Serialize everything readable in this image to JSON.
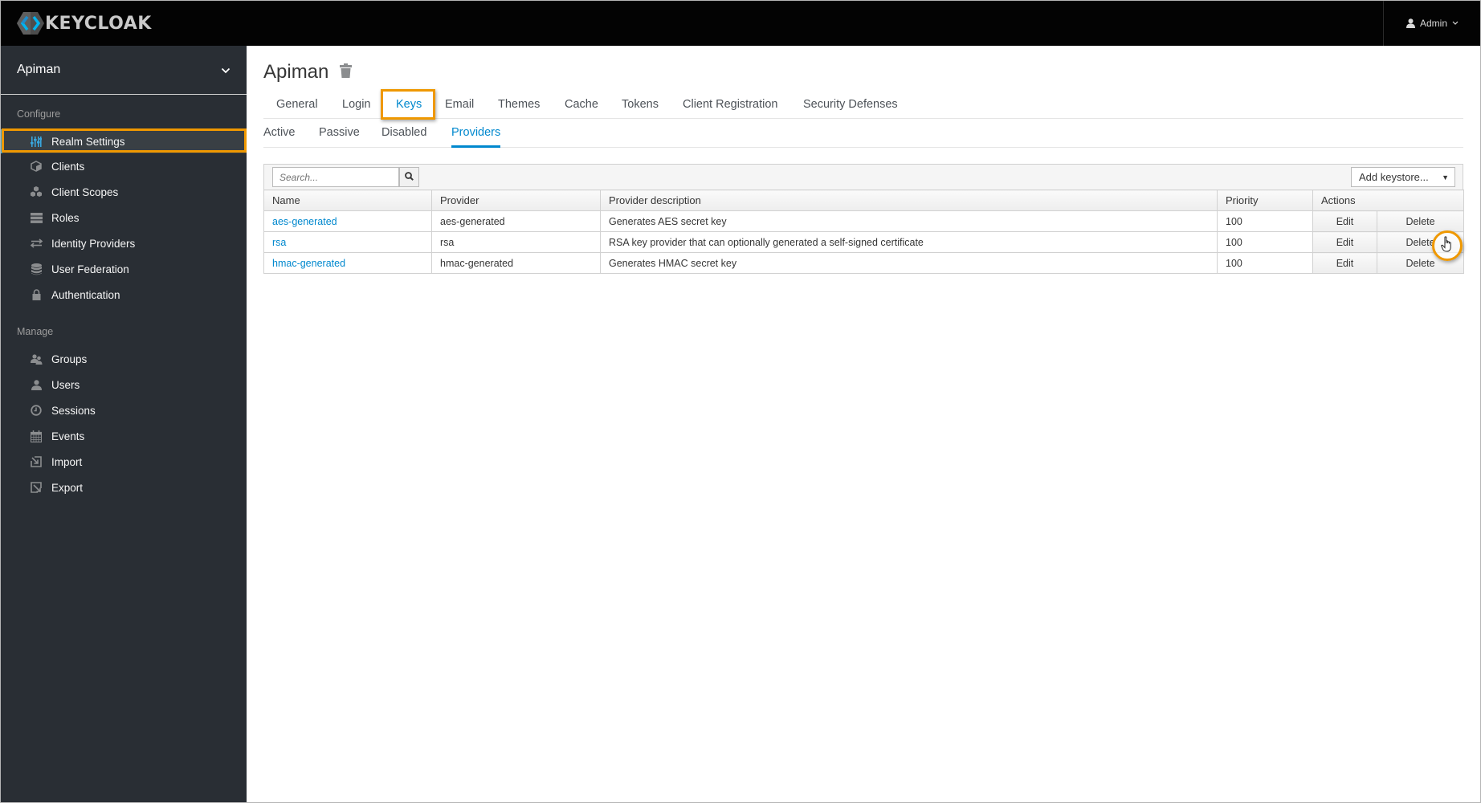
{
  "header": {
    "brand": "KEYCLOAK",
    "user_label": "Admin"
  },
  "sidebar": {
    "realm": "Apiman",
    "sections": [
      {
        "title": "Configure",
        "items": [
          {
            "label": "Realm Settings",
            "icon": "sliders-icon",
            "active": true
          },
          {
            "label": "Clients",
            "icon": "cube-icon"
          },
          {
            "label": "Client Scopes",
            "icon": "cubes-icon"
          },
          {
            "label": "Roles",
            "icon": "server-icon"
          },
          {
            "label": "Identity Providers",
            "icon": "exchange-icon"
          },
          {
            "label": "User Federation",
            "icon": "database-icon"
          },
          {
            "label": "Authentication",
            "icon": "lock-icon"
          }
        ]
      },
      {
        "title": "Manage",
        "items": [
          {
            "label": "Groups",
            "icon": "users-icon"
          },
          {
            "label": "Users",
            "icon": "user-icon"
          },
          {
            "label": "Sessions",
            "icon": "clock-icon"
          },
          {
            "label": "Events",
            "icon": "calendar-icon"
          },
          {
            "label": "Import",
            "icon": "import-icon"
          },
          {
            "label": "Export",
            "icon": "export-icon"
          }
        ]
      }
    ]
  },
  "main": {
    "title": "Apiman",
    "tabs": [
      {
        "label": "General"
      },
      {
        "label": "Login"
      },
      {
        "label": "Keys",
        "active": true
      },
      {
        "label": "Email"
      },
      {
        "label": "Themes"
      },
      {
        "label": "Cache"
      },
      {
        "label": "Tokens"
      },
      {
        "label": "Client Registration"
      },
      {
        "label": "Security Defenses"
      }
    ],
    "subtabs": [
      {
        "label": "Active"
      },
      {
        "label": "Passive"
      },
      {
        "label": "Disabled"
      },
      {
        "label": "Providers",
        "active": true
      }
    ],
    "search": {
      "placeholder": "Search..."
    },
    "add_keystore": "Add keystore...",
    "table": {
      "columns": [
        "Name",
        "Provider",
        "Provider description",
        "Priority",
        "Actions"
      ],
      "rows": [
        {
          "name": "aes-generated",
          "provider": "aes-generated",
          "description": "Generates AES secret key",
          "priority": "100",
          "edit": "Edit",
          "delete": "Delete"
        },
        {
          "name": "rsa",
          "provider": "rsa",
          "description": "RSA key provider that can optionally generated a self-signed certificate",
          "priority": "100",
          "edit": "Edit",
          "delete": "Delete"
        },
        {
          "name": "hmac-generated",
          "provider": "hmac-generated",
          "description": "Generates HMAC secret key",
          "priority": "100",
          "edit": "Edit",
          "delete": "Delete"
        }
      ]
    }
  },
  "colors": {
    "accent": "#0088ce",
    "highlight": "#ef9800",
    "sidebar_bg": "#292e34",
    "header_bg": "#030303"
  }
}
